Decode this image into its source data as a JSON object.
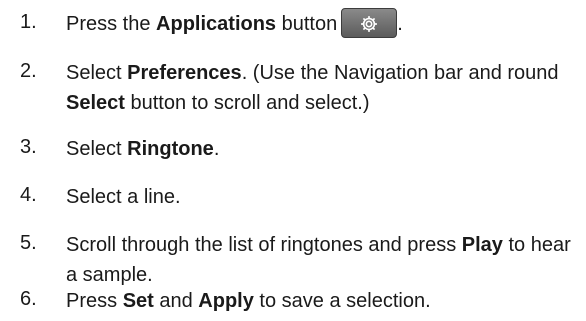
{
  "steps": [
    {
      "number": "1.",
      "pre": "Press the ",
      "bold": "Applications",
      "post": " button",
      "trailing": ".",
      "icon": "gear-icon"
    },
    {
      "number": "2.",
      "pre": "Select ",
      "bold": "Preferences",
      "post": ". (Use the Navigation bar and round ",
      "bold2": "Select",
      "post2": " button to scroll and select.)"
    },
    {
      "number": "3.",
      "pre": "Select ",
      "bold": "Ringtone",
      "post": "."
    },
    {
      "number": "4.",
      "text": "Select a line."
    },
    {
      "number": "5.",
      "pre": "Scroll through the list of ringtones and press ",
      "bold": "Play",
      "post": " to hear a sample."
    },
    {
      "number": "6.",
      "pre": "Press ",
      "bold": "Set",
      "mid": " and ",
      "bold2": "Apply",
      "post": " to save a selection."
    }
  ],
  "colors": {
    "text": "#1a1a1a",
    "button_bg": "#6f6f6f",
    "icon": "#ffffff"
  }
}
